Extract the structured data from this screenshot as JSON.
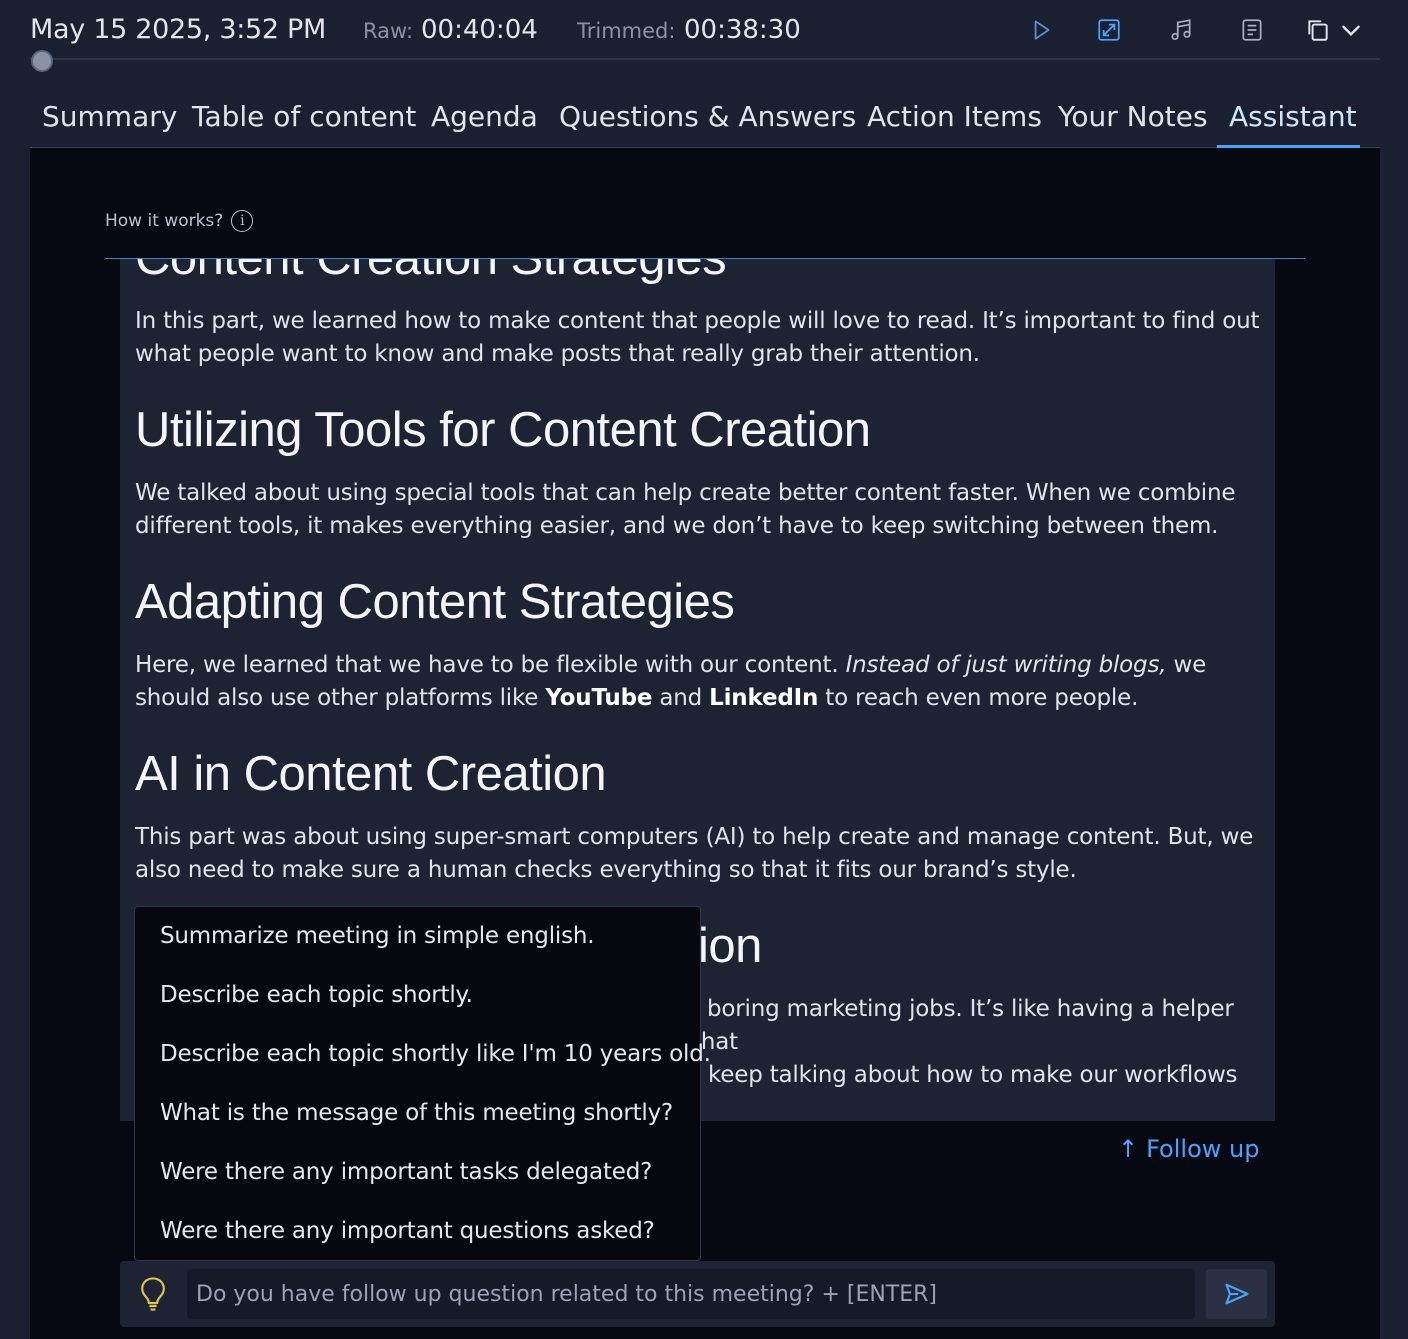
{
  "header": {
    "date": "May 15 2025, 3:52 PM",
    "raw_label": "Raw:",
    "raw_value": "00:40:04",
    "trimmed_label": "Trimmed:",
    "trimmed_value": "00:38:30",
    "toolbar_icons": [
      "play-icon",
      "resize-icon",
      "music-icon",
      "document-icon",
      "copy-icon",
      "chevron-down-icon"
    ]
  },
  "tabs": [
    {
      "label": "Summary"
    },
    {
      "label": "Table of content"
    },
    {
      "label": "Agenda"
    },
    {
      "label": "Questions & Answers"
    },
    {
      "label": "Action Items"
    },
    {
      "label": "Your Notes"
    },
    {
      "label": "Assistant",
      "active": true
    }
  ],
  "assistant": {
    "how_it_works": "How it works?",
    "info_glyph": "i",
    "sections": [
      {
        "heading": "Content Creation Strategies",
        "body": "In this part, we learned how to make content that people will love to read. It’s important to find out what people want to know and make posts that really grab their attention."
      },
      {
        "heading": "Utilizing Tools for Content Creation",
        "body": "We talked about using special tools that can help create better content faster. When we combine different tools, it makes everything easier, and we don’t have to keep switching between them."
      },
      {
        "heading": "Adapting Content Strategies",
        "body_pre": "Here, we learned that we have to be flexible with our content. ",
        "body_em": "Instead of just writing blogs,",
        "body_mid1": " we should also use other platforms like ",
        "body_b1": "YouTube",
        "body_mid2": " and ",
        "body_b2": "LinkedIn",
        "body_post": " to reach even more people."
      },
      {
        "heading": "AI in Content Creation",
        "body": "This part was about using super-smart computers (AI) to help create and manage content. But, we also need to make sure a human checks everything so that it fits our brand’s style."
      },
      {
        "heading_fragment": "ion",
        "body_line1": "f boring marketing jobs. It’s like having a helper that",
        "body_line2": "keep talking about how to make our workflows"
      }
    ],
    "suggestions": [
      "Summarize meeting in simple english.",
      "Describe each topic shortly.",
      "Describe each topic shortly like I'm 10 years old.",
      "What is the message of this meeting shortly?",
      "Were there any important tasks delegated?",
      "Were there any important questions asked?"
    ],
    "follow_up_label": "Follow up",
    "follow_up_arrow": "↑",
    "input_placeholder": "Do you have follow up question related to this meeting? + [ENTER]"
  },
  "colors": {
    "accent": "#4aa3ff",
    "background": "#1b2030",
    "panel": "#060812",
    "card": "#1e2334",
    "bulb": "#d8c64a"
  }
}
